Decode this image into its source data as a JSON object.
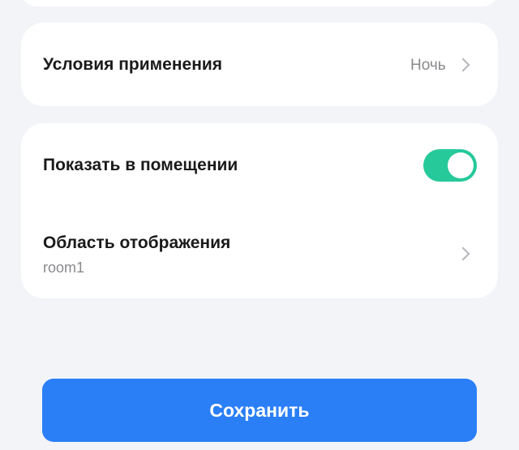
{
  "conditions": {
    "label": "Условия применения",
    "value": "Ночь"
  },
  "display": {
    "show_in_room": {
      "label": "Показать в помещении",
      "enabled": true
    },
    "area": {
      "label": "Область отображения",
      "value": "room1"
    }
  },
  "actions": {
    "save_label": "Сохранить"
  },
  "colors": {
    "background": "#f3f4f8",
    "card": "#ffffff",
    "toggle_on": "#26c99a",
    "primary_button": "#2a7ff7",
    "secondary_text": "#8a8a8e"
  },
  "icons": {
    "row_arrow": "chevron-right-icon"
  }
}
